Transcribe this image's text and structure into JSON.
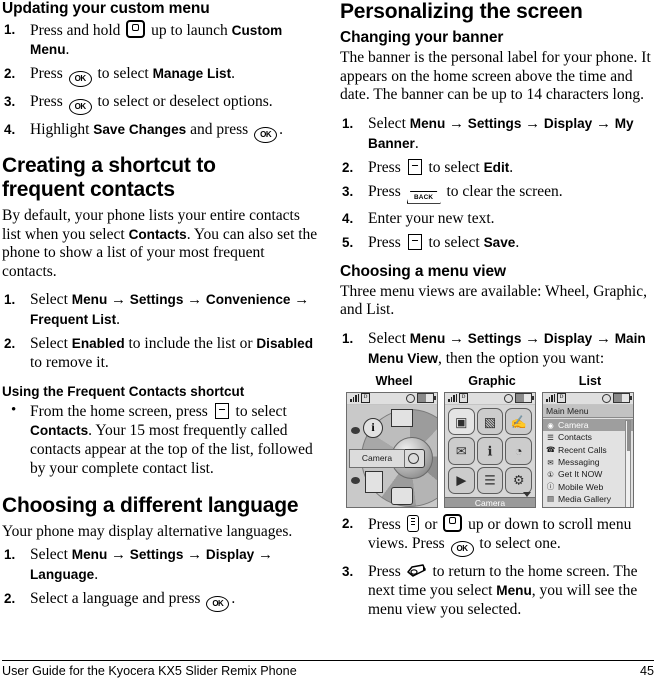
{
  "footer": {
    "text": "User Guide for the Kyocera KX5 Slider Remix Phone",
    "page_number": "45"
  },
  "left_column": {
    "section_updating": {
      "heading": "Updating your custom menu",
      "steps": [
        {
          "num": "1.",
          "parts": [
            {
              "t": "text",
              "v": "Press and hold "
            },
            {
              "t": "icon",
              "v": "nav-key-icon"
            },
            {
              "t": "text",
              "v": " up to launch "
            },
            {
              "t": "bold",
              "v": "Custom Menu"
            },
            {
              "t": "text",
              "v": "."
            }
          ]
        },
        {
          "num": "2.",
          "parts": [
            {
              "t": "text",
              "v": "Press "
            },
            {
              "t": "icon",
              "v": "ok-key-icon"
            },
            {
              "t": "text",
              "v": " to select "
            },
            {
              "t": "bold",
              "v": "Manage List"
            },
            {
              "t": "text",
              "v": "."
            }
          ]
        },
        {
          "num": "3.",
          "parts": [
            {
              "t": "text",
              "v": "Press "
            },
            {
              "t": "icon",
              "v": "ok-key-icon"
            },
            {
              "t": "text",
              "v": " to select or deselect options."
            }
          ]
        },
        {
          "num": "4.",
          "parts": [
            {
              "t": "text",
              "v": "Highlight "
            },
            {
              "t": "bold",
              "v": "Save Changes"
            },
            {
              "t": "text",
              "v": " and press "
            },
            {
              "t": "icon",
              "v": "ok-key-icon"
            },
            {
              "t": "text",
              "v": "."
            }
          ]
        }
      ]
    },
    "section_shortcut": {
      "heading_line1": "Creating a shortcut to",
      "heading_line2": "frequent contacts",
      "intro_parts": [
        {
          "t": "text",
          "v": "By default, your phone lists your entire contacts list when you select "
        },
        {
          "t": "bold",
          "v": "Contacts"
        },
        {
          "t": "text",
          "v": ". You can also set the phone to show a list of your most frequent contacts."
        }
      ],
      "steps": [
        {
          "num": "1.",
          "parts": [
            {
              "t": "text",
              "v": "Select "
            },
            {
              "t": "bold",
              "v": "Menu"
            },
            {
              "t": "arrow",
              "v": "→"
            },
            {
              "t": "bold",
              "v": "Settings"
            },
            {
              "t": "arrow",
              "v": "→"
            },
            {
              "t": "bold",
              "v": "Convenience"
            },
            {
              "t": "arrow",
              "v": "→"
            },
            {
              "t": "bold",
              "v": "Frequent List"
            },
            {
              "t": "text",
              "v": "."
            }
          ]
        },
        {
          "num": "2.",
          "parts": [
            {
              "t": "text",
              "v": "Select "
            },
            {
              "t": "bold",
              "v": "Enabled"
            },
            {
              "t": "text",
              "v": " to include the list or "
            },
            {
              "t": "bold",
              "v": "Disabled"
            },
            {
              "t": "text",
              "v": " to remove it."
            }
          ]
        }
      ],
      "sub_heading": "Using the Frequent Contacts shortcut",
      "bullets": [
        {
          "parts": [
            {
              "t": "text",
              "v": "From the home screen, press "
            },
            {
              "t": "icon",
              "v": "soft-key-icon"
            },
            {
              "t": "text",
              "v": " to select "
            },
            {
              "t": "bold",
              "v": "Contacts"
            },
            {
              "t": "text",
              "v": ". Your 15 most frequently called contacts appear at the top of the list, followed by your complete contact list."
            }
          ]
        }
      ]
    },
    "section_language": {
      "heading": "Choosing a different language",
      "intro": "Your phone may display alternative languages.",
      "steps": [
        {
          "num": "1.",
          "parts": [
            {
              "t": "text",
              "v": "Select "
            },
            {
              "t": "bold",
              "v": "Menu"
            },
            {
              "t": "arrow",
              "v": "→"
            },
            {
              "t": "bold",
              "v": "Settings"
            },
            {
              "t": "arrow",
              "v": "→"
            },
            {
              "t": "bold",
              "v": "Display"
            },
            {
              "t": "arrow",
              "v": "→"
            },
            {
              "t": "bold",
              "v": "Language"
            },
            {
              "t": "text",
              "v": "."
            }
          ]
        },
        {
          "num": "2.",
          "parts": [
            {
              "t": "text",
              "v": "Select a language and press "
            },
            {
              "t": "icon",
              "v": "ok-key-icon"
            },
            {
              "t": "text",
              "v": "."
            }
          ]
        }
      ]
    }
  },
  "right_column": {
    "section_title": "Personalizing the screen",
    "section_banner": {
      "heading": "Changing your banner",
      "intro": "The banner is the personal label for your phone. It appears on the home screen above the time and date. The banner can be up to 14 characters long.",
      "steps": [
        {
          "num": "1.",
          "parts": [
            {
              "t": "text",
              "v": "Select "
            },
            {
              "t": "bold",
              "v": "Menu"
            },
            {
              "t": "arrow",
              "v": "→"
            },
            {
              "t": "bold",
              "v": "Settings"
            },
            {
              "t": "arrow",
              "v": "→"
            },
            {
              "t": "bold",
              "v": "Display"
            },
            {
              "t": "arrow",
              "v": "→"
            },
            {
              "t": "bold",
              "v": "My Banner"
            },
            {
              "t": "text",
              "v": "."
            }
          ]
        },
        {
          "num": "2.",
          "parts": [
            {
              "t": "text",
              "v": "Press "
            },
            {
              "t": "icon",
              "v": "soft-key-icon"
            },
            {
              "t": "text",
              "v": " to select "
            },
            {
              "t": "bold",
              "v": "Edit"
            },
            {
              "t": "text",
              "v": "."
            }
          ]
        },
        {
          "num": "3.",
          "parts": [
            {
              "t": "text",
              "v": "Press "
            },
            {
              "t": "icon",
              "v": "back-key-icon"
            },
            {
              "t": "text",
              "v": " to clear the screen."
            }
          ]
        },
        {
          "num": "4.",
          "parts": [
            {
              "t": "text",
              "v": "Enter your new text."
            }
          ]
        },
        {
          "num": "5.",
          "parts": [
            {
              "t": "text",
              "v": "Press "
            },
            {
              "t": "icon",
              "v": "soft-key-icon"
            },
            {
              "t": "text",
              "v": " to select "
            },
            {
              "t": "bold",
              "v": "Save"
            },
            {
              "t": "text",
              "v": "."
            }
          ]
        }
      ]
    },
    "section_menu_view": {
      "heading": "Choosing a menu view",
      "intro": "Three menu views are available: Wheel, Graphic, and List.",
      "step1": {
        "num": "1.",
        "parts": [
          {
            "t": "text",
            "v": "Select "
          },
          {
            "t": "bold",
            "v": "Menu"
          },
          {
            "t": "arrow",
            "v": "→"
          },
          {
            "t": "bold",
            "v": "Settings"
          },
          {
            "t": "arrow",
            "v": "→"
          },
          {
            "t": "bold",
            "v": "Display"
          },
          {
            "t": "arrow",
            "v": "→"
          },
          {
            "t": "bold",
            "v": "Main Menu View"
          },
          {
            "t": "text",
            "v": ", then the option you want:"
          }
        ]
      },
      "figures": {
        "wheel": {
          "caption": "Wheel",
          "selected_label": "Camera",
          "icons": [
            "info-icon",
            "calculator-icon",
            "address-book-icon",
            "hand-icon",
            "camera-icon"
          ]
        },
        "graphic": {
          "caption": "Graphic",
          "soft_key_label": "Camera",
          "cells": [
            {
              "name": "camera-icon",
              "glyph": "▣",
              "selected": true
            },
            {
              "name": "contacts-book-icon",
              "glyph": "▧",
              "selected": false
            },
            {
              "name": "messaging-hand-icon",
              "glyph": "✍",
              "selected": false
            },
            {
              "name": "envelope-icon",
              "glyph": "✉",
              "selected": false
            },
            {
              "name": "get-it-now-icon",
              "glyph": "ℹ",
              "selected": false
            },
            {
              "name": "mobile-web-icon",
              "glyph": "◔",
              "selected": false
            },
            {
              "name": "media-gallery-icon",
              "glyph": "▶",
              "selected": false
            },
            {
              "name": "settings-icon",
              "glyph": "☰",
              "selected": false
            },
            {
              "name": "tools-icon",
              "glyph": "⚙",
              "selected": false
            }
          ]
        },
        "list": {
          "caption": "List",
          "title": "Main Menu",
          "items": [
            {
              "label": "Camera",
              "icon": "camera-icon",
              "glyph": "◉",
              "selected": true
            },
            {
              "label": "Contacts",
              "icon": "contacts-icon",
              "glyph": "☰",
              "selected": false
            },
            {
              "label": "Recent Calls",
              "icon": "recent-calls-icon",
              "glyph": "☎",
              "selected": false
            },
            {
              "label": "Messaging",
              "icon": "messaging-icon",
              "glyph": "✉",
              "selected": false
            },
            {
              "label": "Get It NOW",
              "icon": "get-it-now-icon",
              "glyph": "①",
              "selected": false
            },
            {
              "label": "Mobile Web",
              "icon": "mobile-web-icon",
              "glyph": "ⓘ",
              "selected": false
            },
            {
              "label": "Media Gallery",
              "icon": "media-gallery-icon",
              "glyph": "▤",
              "selected": false
            }
          ]
        }
      },
      "steps_after": [
        {
          "num": "2.",
          "parts": [
            {
              "t": "text",
              "v": "Press "
            },
            {
              "t": "icon",
              "v": "menu-key-icon"
            },
            {
              "t": "text",
              "v": " or "
            },
            {
              "t": "icon",
              "v": "nav-key-icon"
            },
            {
              "t": "text",
              "v": " up or down to scroll menu views. Press "
            },
            {
              "t": "icon",
              "v": "ok-key-icon"
            },
            {
              "t": "text",
              "v": " to select one."
            }
          ]
        },
        {
          "num": "3.",
          "parts": [
            {
              "t": "text",
              "v": "Press "
            },
            {
              "t": "icon",
              "v": "end-call-key-icon"
            },
            {
              "t": "text",
              "v": " to return to the home screen. The next time you select "
            },
            {
              "t": "bold",
              "v": "Menu"
            },
            {
              "t": "text",
              "v": ", you will see the menu view you selected."
            }
          ]
        }
      ]
    }
  }
}
